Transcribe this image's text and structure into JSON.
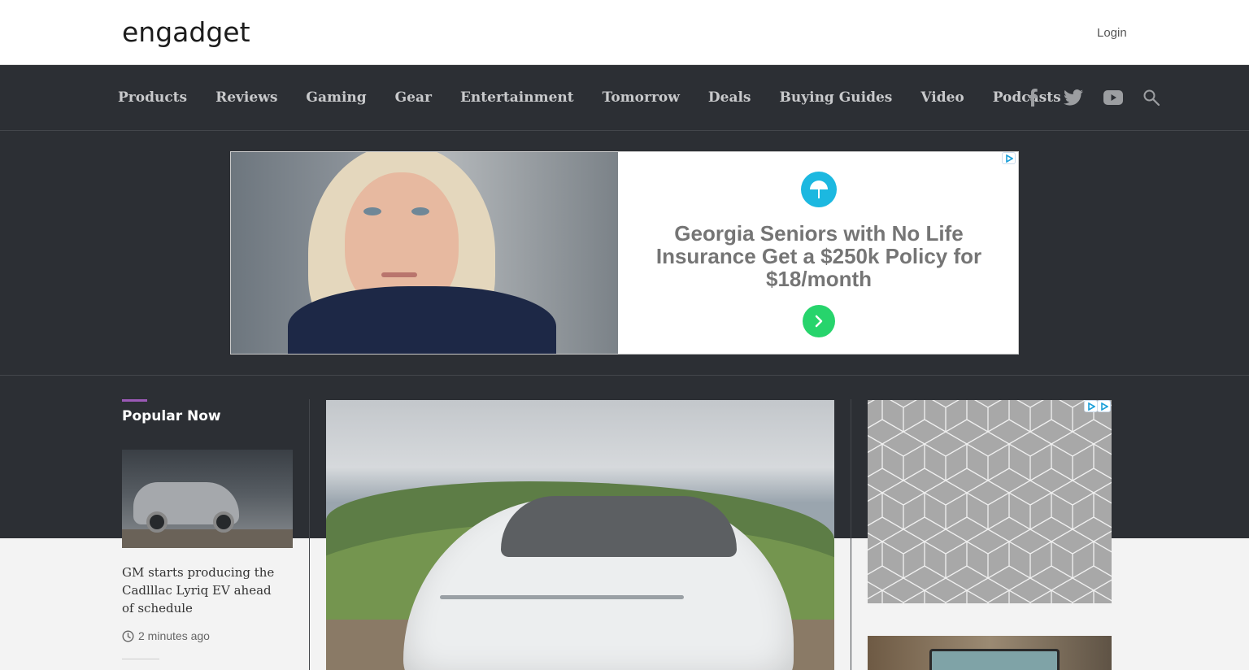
{
  "header": {
    "logo_text": "engadget",
    "login_label": "Login"
  },
  "nav": {
    "items": [
      {
        "label": "Products"
      },
      {
        "label": "Reviews"
      },
      {
        "label": "Gaming"
      },
      {
        "label": "Gear"
      },
      {
        "label": "Entertainment"
      },
      {
        "label": "Tomorrow"
      },
      {
        "label": "Deals"
      },
      {
        "label": "Buying Guides"
      },
      {
        "label": "Video"
      },
      {
        "label": "Podcasts"
      }
    ],
    "social_icons": [
      "facebook-icon",
      "twitter-icon",
      "youtube-icon",
      "search-icon"
    ]
  },
  "banner_ad": {
    "headline": "Georgia Seniors with No Life Insurance Get a $250k Policy for $18/month",
    "accent_color": "#1cb8e0",
    "cta_color": "#27d46c"
  },
  "popular": {
    "heading": "Popular Now",
    "accent_color": "#9b59b6",
    "items": [
      {
        "title": "GM starts producing the Cadlllac Lyriq EV ahead of schedule",
        "time": "2 minutes ago"
      }
    ]
  },
  "colors": {
    "nav_bg": "#2c2f34",
    "header_bg": "#ffffff",
    "content_bg": "#f3f3f3"
  }
}
